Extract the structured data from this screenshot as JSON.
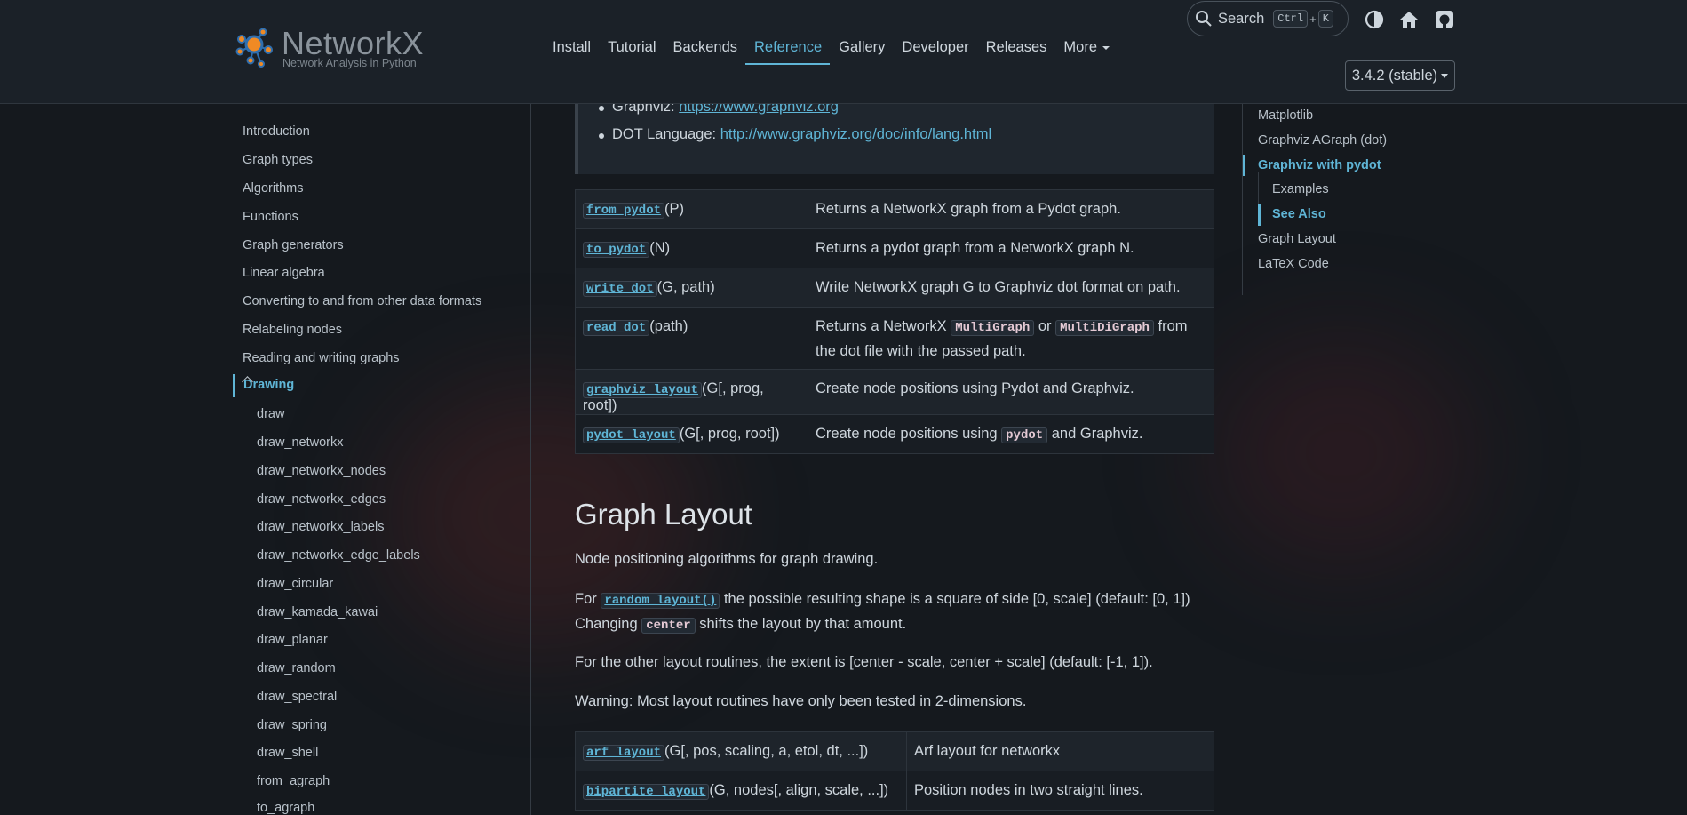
{
  "header": {
    "logo_title": "NetworkX",
    "logo_subtitle": "Network Analysis in Python",
    "nav": [
      "Install",
      "Tutorial",
      "Backends",
      "Reference",
      "Gallery",
      "Developer",
      "Releases"
    ],
    "nav_more": "More",
    "search": {
      "label": "Search",
      "kbd1": "Ctrl",
      "plus": "+",
      "kbd2": "K"
    },
    "version": "3.4.2 (stable)"
  },
  "sidebar": {
    "items": [
      "Introduction",
      "Graph types",
      "Algorithms",
      "Functions",
      "Graph generators",
      "Linear algebra",
      "Converting to and from other data formats",
      "Relabeling nodes",
      "Reading and writing graphs"
    ],
    "active": "Drawing",
    "subitems": [
      "draw",
      "draw_networkx",
      "draw_networkx_nodes",
      "draw_networkx_edges",
      "draw_networkx_labels",
      "draw_networkx_edge_labels",
      "draw_circular",
      "draw_kamada_kawai",
      "draw_planar",
      "draw_random",
      "draw_spectral",
      "draw_spring",
      "draw_shell",
      "from_agraph",
      "to_agraph"
    ]
  },
  "note": {
    "li1_label": "Graphviz: ",
    "li1_link": "https://www.graphviz.org",
    "li2_label": "DOT Language: ",
    "li2_link": "http://www.graphviz.org/doc/info/lang.html"
  },
  "pydot_table": [
    {
      "fn": "from_pydot",
      "sig": "(P)",
      "desc": "Returns a NetworkX graph from a Pydot graph."
    },
    {
      "fn": "to_pydot",
      "sig": "(N)",
      "desc": "Returns a pydot graph from a NetworkX graph N."
    },
    {
      "fn": "write_dot",
      "sig": "(G, path)",
      "desc": "Write NetworkX graph G to Graphviz dot format on path."
    },
    {
      "fn": "read_dot",
      "sig": "(path)",
      "desc_pre": "Returns a NetworkX ",
      "code1": "MultiGraph",
      "desc_mid": " or ",
      "code2": "MultiDiGraph",
      "desc_post": " from the dot file with the passed path."
    },
    {
      "fn": "graphviz_layout",
      "sig": "(G[, prog, root])",
      "desc": "Create node positions using Pydot and Graphviz."
    },
    {
      "fn": "pydot_layout",
      "sig": "(G[, prog, root])",
      "desc_pre": "Create node positions using ",
      "code1": "pydot",
      "desc_post": " and Graphviz."
    }
  ],
  "section": {
    "title": "Graph Layout",
    "intro": "Node positioning algorithms for graph drawing.",
    "p2_a": "For ",
    "p2_code1": "random_layout()",
    "p2_b": " the possible resulting shape is a square of side [0, scale] (default: [0, 1])",
    "p2_c": "Changing ",
    "p2_code2": "center",
    "p2_d": " shifts the layout by that amount.",
    "p3": "For the other layout routines, the extent is [center - scale, center + scale] (default: [-1, 1]).",
    "p4": "Warning: Most layout routines have only been tested in 2-dimensions."
  },
  "layout_table": [
    {
      "fn": "arf_layout",
      "sig": "(G[, pos, scaling, a, etol, dt, ...])",
      "desc": "Arf layout for networkx"
    },
    {
      "fn": "bipartite_layout",
      "sig": "(G, nodes[, align, scale, ...])",
      "desc": "Position nodes in two straight lines."
    }
  ],
  "toc": {
    "items": [
      "Matplotlib",
      "Graphviz AGraph (dot)",
      "Graphviz with pydot",
      "Examples",
      "See Also",
      "Graph Layout",
      "LaTeX Code"
    ]
  },
  "colors": {
    "accent": "#5fb5d6",
    "background": "#15191e",
    "header": "#1b2128"
  }
}
